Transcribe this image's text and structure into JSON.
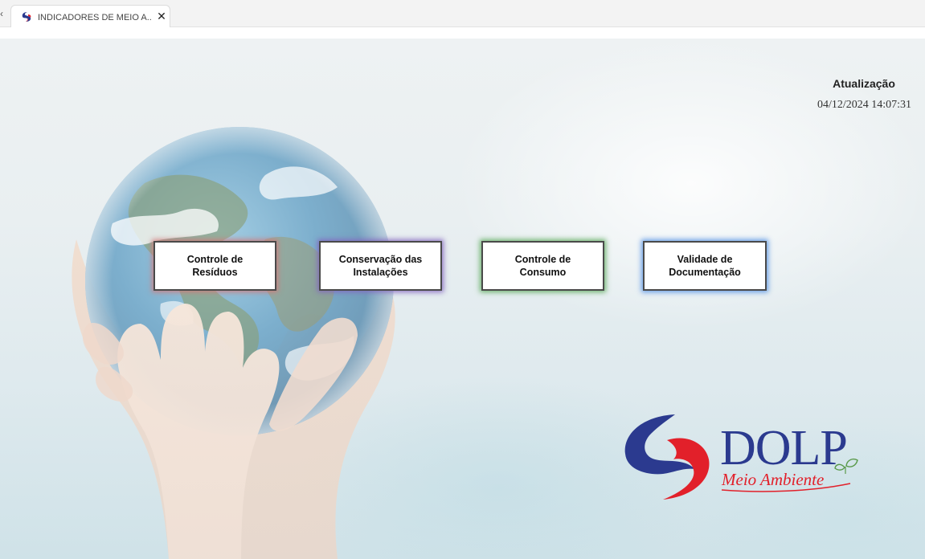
{
  "browser": {
    "tab_title": "INDICADORES DE MEIO A...",
    "tab_close": "✕",
    "tab_prev": "‹",
    "favicon": "dolp-logo-icon"
  },
  "header": {
    "update_label": "Atualização",
    "update_value": "04/12/2024 14:07:31"
  },
  "nav": {
    "buttons": [
      {
        "label": "Controle de Resíduos",
        "glow_color": "#d27878"
      },
      {
        "label": "Conservação das Instalações",
        "glow_color": "#8264be"
      },
      {
        "label": "Controle de Consumo",
        "glow_color": "#5aaa5a"
      },
      {
        "label": "Validade de Documentação",
        "glow_color": "#5a96e6"
      }
    ]
  },
  "brand": {
    "name": "DOLP",
    "subtitle": "Meio Ambiente",
    "blue": "#2b3a8f",
    "red": "#e2202a",
    "leaf_green": "#5a9a4a"
  }
}
